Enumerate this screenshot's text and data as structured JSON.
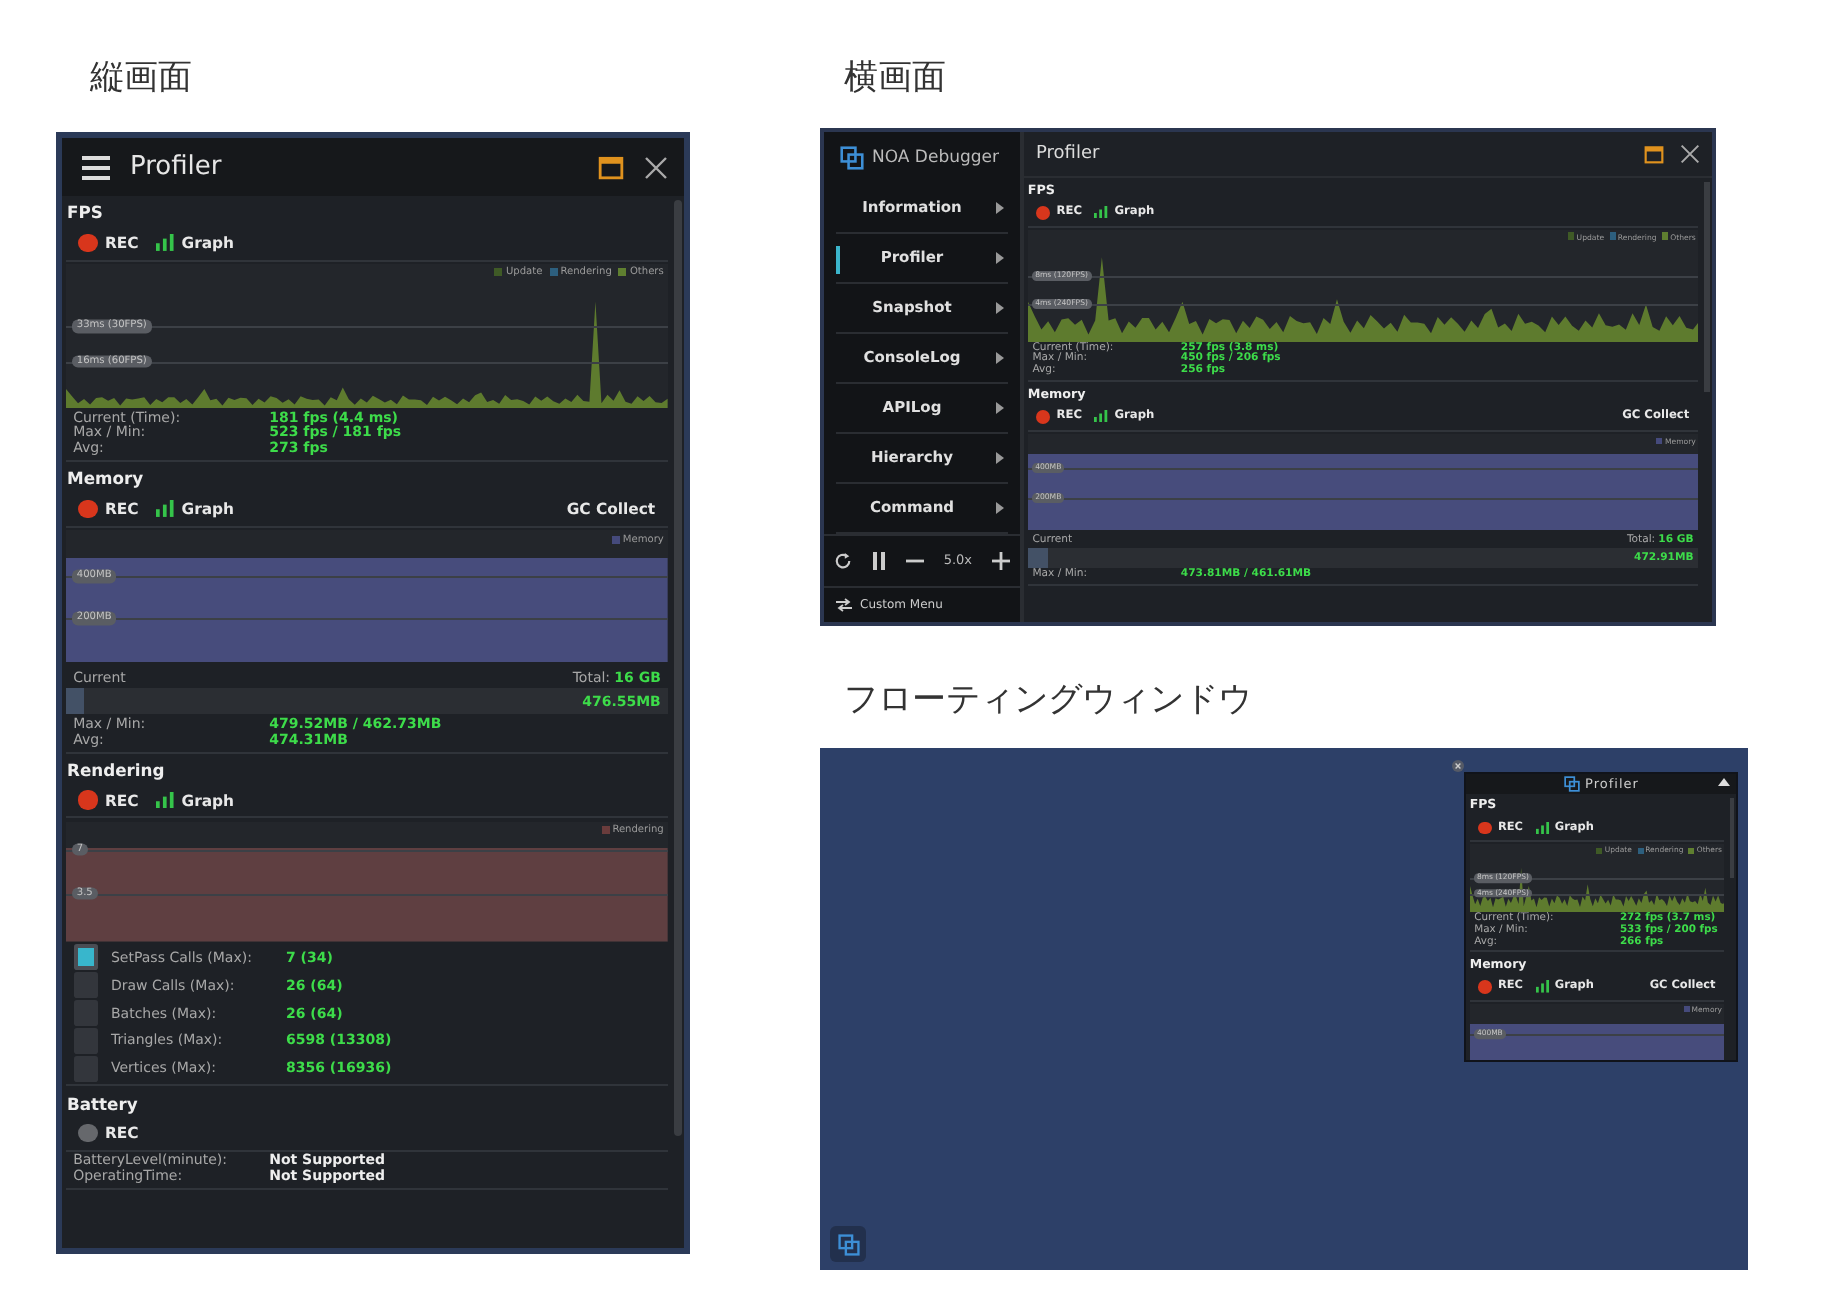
{
  "portrait": {
    "caption": "縦画面",
    "title": "Profiler",
    "sections": [
      {
        "kind": "fps",
        "title": "FPS",
        "recording": true,
        "rec": "REC",
        "graph": "Graph",
        "legend": [
          {
            "label": "Update",
            "color": "#3f5a26"
          },
          {
            "label": "Rendering",
            "color": "#2d5f7e"
          },
          {
            "label": "Others",
            "color": "#5f7f30"
          }
        ],
        "gridlines": [
          "33ms (30FPS)",
          "16ms (60FPS)"
        ],
        "stats": [
          {
            "label": "Current (Time):",
            "value": "181 fps (4.4 ms)"
          },
          {
            "label": "Max / Min:",
            "value": "523 fps / 181 fps"
          },
          {
            "label": "Avg:",
            "value": "273 fps"
          }
        ]
      },
      {
        "kind": "memory",
        "title": "Memory",
        "recording": true,
        "rec": "REC",
        "graph": "Graph",
        "action": "GC Collect",
        "legend": [
          {
            "label": "Memory",
            "color": "#454a7c"
          }
        ],
        "gridlines": [
          "400MB",
          "200MB"
        ],
        "current_label": "Current",
        "total_label": "Total:",
        "total": "16 GB",
        "level": 0.03,
        "current": "476.55MB",
        "stats": [
          {
            "label": "Max / Min:",
            "value": "479.52MB / 462.73MB"
          },
          {
            "label": "Avg:",
            "value": "474.31MB"
          }
        ]
      },
      {
        "kind": "rendering",
        "title": "Rendering",
        "recording": true,
        "rec": "REC",
        "graph": "Graph",
        "legend": [
          {
            "label": "Rendering",
            "color": "#6a3c3c"
          }
        ],
        "gridlines": [
          "7",
          "3.5"
        ],
        "metrics": [
          {
            "label": "SetPass Calls (Max):",
            "value": "7 (34)",
            "selected": true
          },
          {
            "label": "Draw Calls (Max):",
            "value": "26 (64)",
            "selected": false
          },
          {
            "label": "Batches (Max):",
            "value": "26 (64)",
            "selected": false
          },
          {
            "label": "Triangles (Max):",
            "value": "6598 (13308)",
            "selected": false
          },
          {
            "label": "Vertices (Max):",
            "value": "8356 (16936)",
            "selected": false
          }
        ]
      },
      {
        "kind": "battery",
        "title": "Battery",
        "recording": false,
        "rec": "REC",
        "stats": [
          {
            "label": "BatteryLevel(minute):",
            "value": "Not Supported"
          },
          {
            "label": "OperatingTime:",
            "value": "Not Supported"
          }
        ]
      }
    ]
  },
  "landscape": {
    "caption": "横画面",
    "app_name": "NOA Debugger",
    "menu": [
      {
        "label": "Information",
        "selected": false
      },
      {
        "label": "Profiler",
        "selected": true
      },
      {
        "label": "Snapshot",
        "selected": false
      },
      {
        "label": "ConsoleLog",
        "selected": false
      },
      {
        "label": "APILog",
        "selected": false
      },
      {
        "label": "Hierarchy",
        "selected": false
      },
      {
        "label": "Command",
        "selected": false
      }
    ],
    "speed": "5.0x",
    "custom_menu": "Custom Menu",
    "title": "Profiler",
    "sections": [
      {
        "kind": "fps",
        "title": "FPS",
        "recording": true,
        "rec": "REC",
        "graph": "Graph",
        "legend": [
          {
            "label": "Update",
            "color": "#3f5a26"
          },
          {
            "label": "Rendering",
            "color": "#2d5f7e"
          },
          {
            "label": "Others",
            "color": "#5f7f30"
          }
        ],
        "gridlines": [
          "8ms (120FPS)",
          "4ms (240FPS)"
        ],
        "stats": [
          {
            "label": "Current (Time):",
            "value": "257 fps (3.8 ms)"
          },
          {
            "label": "Max / Min:",
            "value": "450 fps / 206 fps"
          },
          {
            "label": "Avg:",
            "value": "256 fps"
          }
        ]
      },
      {
        "kind": "memory",
        "title": "Memory",
        "recording": true,
        "rec": "REC",
        "graph": "Graph",
        "action": "GC Collect",
        "legend": [
          {
            "label": "Memory",
            "color": "#454a7c"
          }
        ],
        "gridlines": [
          "400MB",
          "200MB"
        ],
        "current_label": "Current",
        "total_label": "Total:",
        "total": "16 GB",
        "level": 0.03,
        "current": "472.91MB",
        "stats": [
          {
            "label": "Max / Min:",
            "value": "473.81MB / 461.61MB"
          }
        ]
      }
    ]
  },
  "floating": {
    "caption": "フローティングウィンドウ",
    "title": "Profiler",
    "sections": [
      {
        "kind": "fps",
        "title": "FPS",
        "recording": true,
        "rec": "REC",
        "graph": "Graph",
        "legend": [
          {
            "label": "Update",
            "color": "#3f5a26"
          },
          {
            "label": "Rendering",
            "color": "#2d5f7e"
          },
          {
            "label": "Others",
            "color": "#5f7f30"
          }
        ],
        "gridlines": [
          "8ms (120FPS)",
          "4ms (240FPS)"
        ],
        "stats": [
          {
            "label": "Current (Time):",
            "value": "272 fps (3.7 ms)"
          },
          {
            "label": "Max / Min:",
            "value": "533 fps / 200 fps"
          },
          {
            "label": "Avg:",
            "value": "266 fps"
          }
        ]
      },
      {
        "kind": "memory",
        "title": "Memory",
        "recording": true,
        "rec": "REC",
        "graph": "Graph",
        "action": "GC Collect",
        "legend": [
          {
            "label": "Memory",
            "color": "#454a7c"
          }
        ],
        "gridlines": [
          "400MB"
        ]
      }
    ]
  }
}
